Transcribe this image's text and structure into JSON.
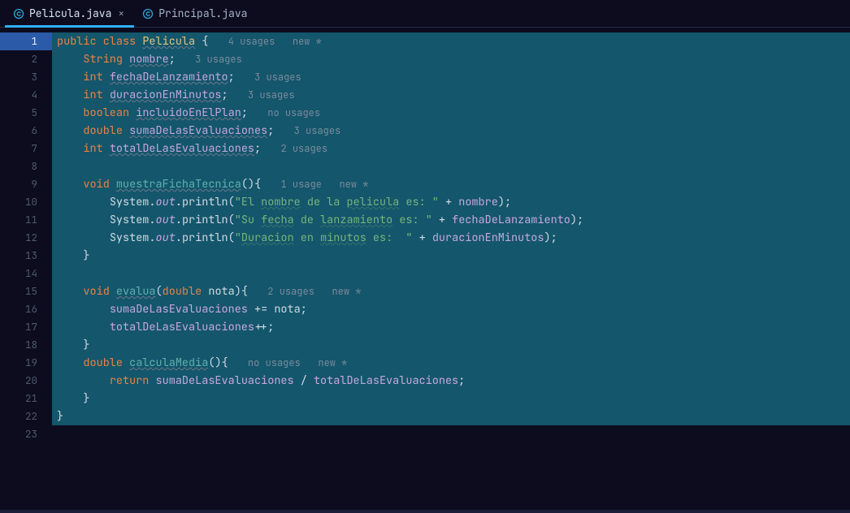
{
  "tabs": [
    {
      "label": "Pelicula.java",
      "active": true,
      "closeable": true
    },
    {
      "label": "Principal.java",
      "active": false,
      "closeable": false
    }
  ],
  "gutter": {
    "lines": [
      "1",
      "2",
      "3",
      "4",
      "5",
      "6",
      "7",
      "8",
      "9",
      "10",
      "11",
      "12",
      "13",
      "14",
      "15",
      "16",
      "17",
      "18",
      "19",
      "20",
      "21",
      "22",
      "23"
    ],
    "current": 1
  },
  "hints": {
    "l1": "4 usages   new *",
    "l2": "3 usages",
    "l3": "3 usages",
    "l4": "3 usages",
    "l5": "no usages",
    "l6": "3 usages",
    "l7": "2 usages",
    "l9": "1 usage   new *",
    "l15": "2 usages   new *",
    "l19": "no usages   new *"
  },
  "tok": {
    "kw_public": "public",
    "kw_class": "class",
    "kw_void": "void",
    "kw_return": "return",
    "ty_String": "String",
    "ty_int": "int",
    "ty_boolean": "boolean",
    "ty_double": "double",
    "cls_Pelicula": "Pelicula",
    "f_nombre": "nombre",
    "f_fechaDeLanzamiento": "fechaDeLanzamiento",
    "f_duracionEnMinutos": "duracionEnMinutos",
    "f_incluidoEnElPlan": "incluidoEnElPlan",
    "f_sumaDeLasEvaluaciones": "sumaDeLasEvaluaciones",
    "f_totalDeLasEvaluaciones": "totalDeLasEvaluaciones",
    "m_muestraFichaTecnica": "muestraFichaTecnica",
    "m_evalua": "evalua",
    "m_calculaMedia": "calculaMedia",
    "p_nota": "nota",
    "System": "System",
    "out": "out",
    "println": "println",
    "s1a": "\"El ",
    "s1b": "nombre",
    "s1c": " de la ",
    "s1d": "pelicula",
    "s1e": " es: \"",
    "s2a": "\"Su ",
    "s2b": "fecha",
    "s2c": " de ",
    "s2d": "lanzamiento",
    "s2e": " es: \"",
    "s3a": "\"",
    "s3b": "Duracion",
    "s3c": " en ",
    "s3d": "minutos",
    "s3e": " es:  \"",
    "semi": ";",
    "lbrace": "{",
    "rbrace": "}",
    "lpar": "(",
    "rpar": ")",
    "plus": " + ",
    "comma": ",",
    "div": " / ",
    "peq": " += ",
    "pp": "++"
  }
}
